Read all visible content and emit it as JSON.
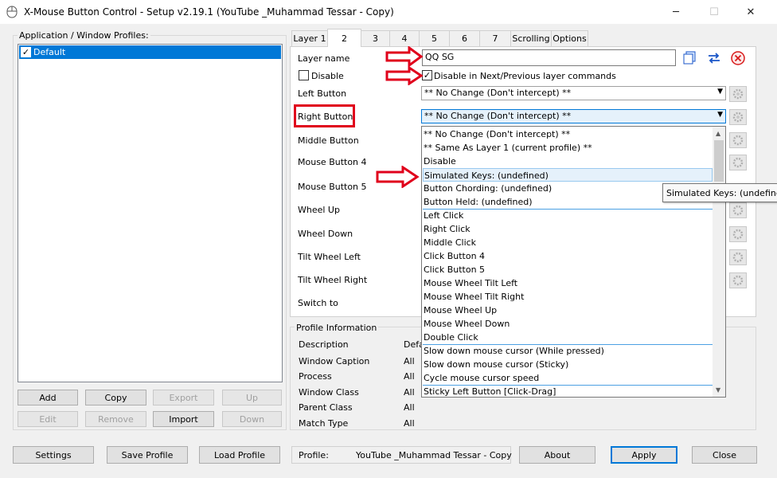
{
  "window": {
    "title": "X-Mouse Button Control - Setup v2.19.1 (YouTube _Muhammad Tessar - Copy)",
    "minimize": "─",
    "maximize": "☐",
    "close": "✕"
  },
  "profiles": {
    "group_label": "Application / Window Profiles:",
    "items": [
      {
        "label": "Default",
        "checked": true
      }
    ],
    "buttons": {
      "add": "Add",
      "copy": "Copy",
      "export": "Export",
      "up": "Up",
      "edit": "Edit",
      "remove": "Remove",
      "import": "Import",
      "down": "Down"
    }
  },
  "tabs": [
    "Layer 1",
    "2",
    "3",
    "4",
    "5",
    "6",
    "7",
    "Scrolling",
    "Options"
  ],
  "layer": {
    "name_label": "Layer name",
    "name_value": "QQ SG",
    "disable_label": "Disable",
    "disable_next_prev_label": "Disable in Next/Previous layer commands",
    "left_button_label": "Left Button",
    "left_button_value": "** No Change (Don't intercept) **",
    "right_button_label": "Right Button",
    "right_button_value": "** No Change (Don't intercept) **",
    "rows": [
      "Middle Button",
      "Mouse Button 4",
      "Mouse Button 5",
      "Wheel Up",
      "Wheel Down",
      "Tilt Wheel Left",
      "Tilt Wheel Right",
      "Switch to"
    ]
  },
  "dropdown": {
    "items": [
      "** No Change (Don't intercept) **",
      "** Same As Layer 1 (current profile) **",
      "Disable",
      "Simulated Keys: (undefined)",
      "Button Chording: (undefined)",
      "Button Held: (undefined)",
      "Left Click",
      "Right Click",
      "Middle Click",
      "Click Button 4",
      "Click Button 5",
      "Mouse Wheel Tilt Left",
      "Mouse Wheel Tilt Right",
      "Mouse Wheel Up",
      "Mouse Wheel Down",
      "Double Click",
      "Slow down mouse cursor (While pressed)",
      "Slow down mouse cursor (Sticky)",
      "Cycle mouse cursor speed",
      "Sticky Left Button [Click-Drag]"
    ],
    "highlighted": "Simulated Keys: (undefined)"
  },
  "tooltip": "Simulated Keys: (undefined)",
  "profile_info": {
    "group_label": "Profile Information",
    "rows": [
      {
        "label": "Description",
        "value": "Defa"
      },
      {
        "label": "Window Caption",
        "value": "All"
      },
      {
        "label": "Process",
        "value": "All"
      },
      {
        "label": "Window Class",
        "value": "All"
      },
      {
        "label": "Parent Class",
        "value": "All"
      },
      {
        "label": "Match Type",
        "value": "All"
      }
    ]
  },
  "bottom": {
    "settings": "Settings",
    "save_profile": "Save Profile",
    "load_profile": "Load Profile",
    "profile_label": "Profile:",
    "profile_value": "YouTube _Muhammad Tessar - Copy",
    "about": "About",
    "apply": "Apply",
    "close": "Close"
  },
  "colors": {
    "annotation": "#e0001b",
    "selection": "#0078d7"
  }
}
